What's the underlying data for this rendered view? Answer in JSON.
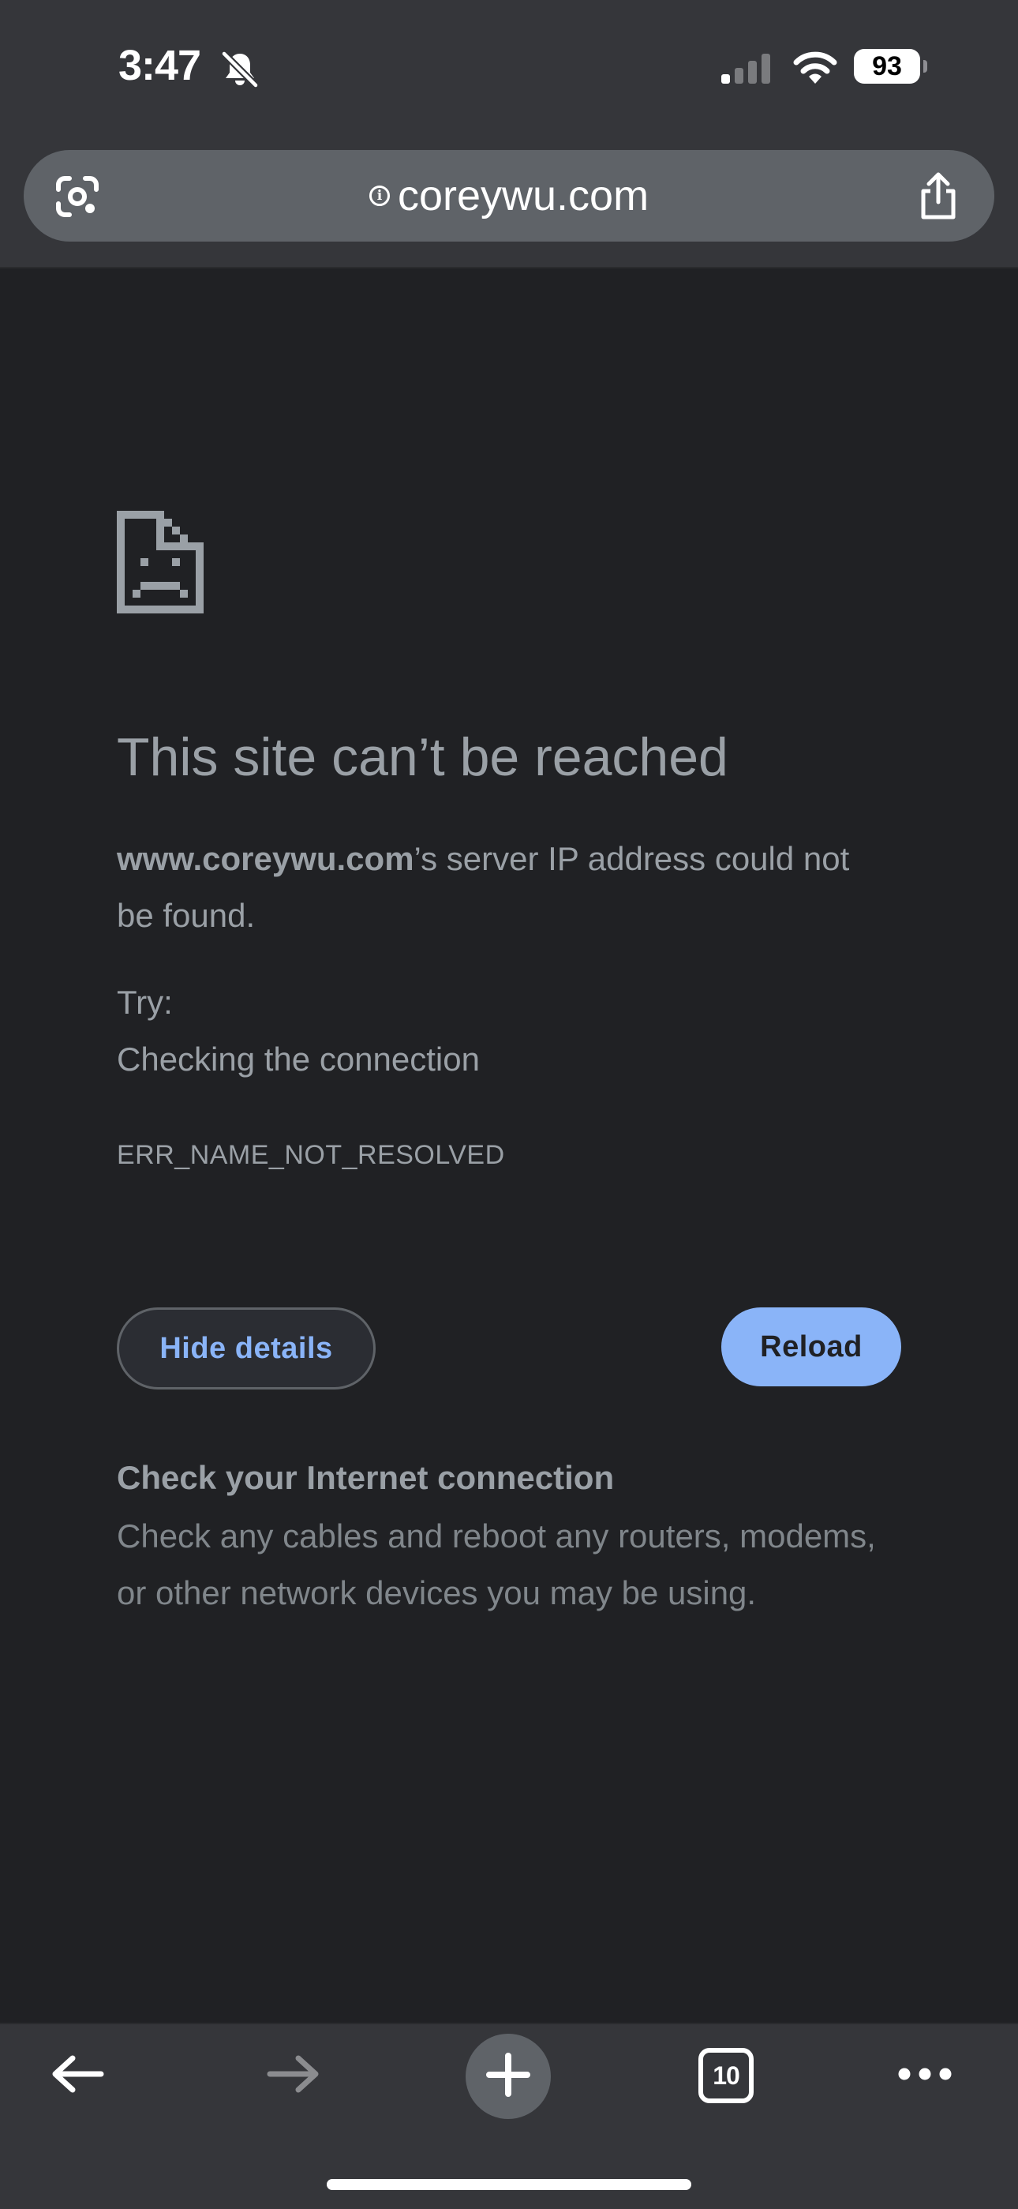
{
  "status_bar": {
    "time": "3:47",
    "battery_level": "93",
    "icons": [
      "bell-slash-icon",
      "cellular-signal-icon",
      "wifi-icon",
      "battery-icon"
    ]
  },
  "address_bar": {
    "url": "coreywu.com",
    "icons": [
      "lens-icon",
      "info-icon",
      "share-icon"
    ]
  },
  "error_page": {
    "icon": "sad-document-icon",
    "title": "This site can’t be reached",
    "description_host": "www.coreywu.com",
    "description_rest": "’s server IP address could not be found.",
    "try_label": "Try:",
    "try_items": [
      "Checking the connection"
    ],
    "error_code": "ERR_NAME_NOT_RESOLVED",
    "hide_details_label": "Hide details",
    "reload_label": "Reload",
    "details_heading": "Check your Internet connection",
    "details_body": "Check any cables and reboot any routers, modems, or other network devices you may be using."
  },
  "toolbar": {
    "tab_count": "10",
    "icons": [
      "back-arrow-icon",
      "forward-arrow-icon",
      "plus-icon",
      "tab-switcher-icon",
      "more-dots-icon"
    ]
  },
  "colors": {
    "page_background": "#202124",
    "chrome_background": "#35363a",
    "address_pill": "#5f6368",
    "accent_blue": "#8ab4f8",
    "text_gray": "#9aa0a6"
  }
}
